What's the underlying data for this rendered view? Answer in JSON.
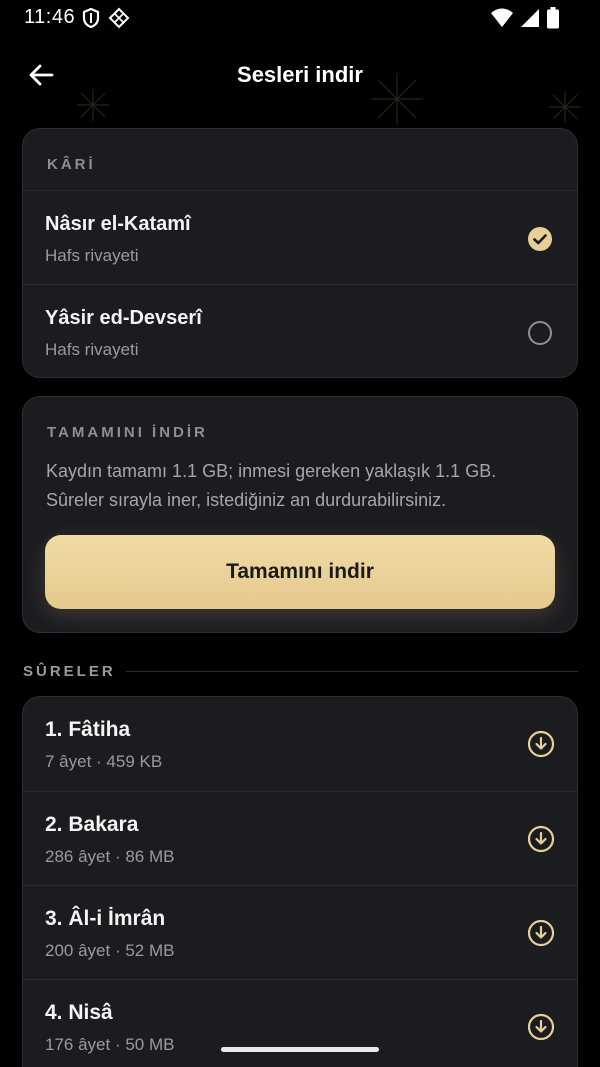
{
  "status_bar": {
    "time": "11:46"
  },
  "header": {
    "title": "Sesleri indir",
    "back_icon": "arrow-left-icon"
  },
  "reciter": {
    "section_label": "KÂRİ",
    "items": [
      {
        "name": "Nâsır el-Katamî",
        "subtitle": "Hafs rivayeti",
        "selected": true
      },
      {
        "name": "Yâsir ed-Devserî",
        "subtitle": "Hafs rivayeti",
        "selected": false
      }
    ]
  },
  "download_all": {
    "section_label": "TAMAMINI İNDİR",
    "line1": "Kaydın tamamı 1.1 GB; inmesi gereken yaklaşık 1.1 GB.",
    "line2": "Sûreler sırayla iner, istediğiniz an durdurabilirsiniz.",
    "button_label": "Tamamını indir"
  },
  "surahs": {
    "section_label": "SÛRELER",
    "items": [
      {
        "name": "1. Fâtiha",
        "meta": "7 âyet · 459 KB"
      },
      {
        "name": "2. Bakara",
        "meta": "286 âyet · 86 MB"
      },
      {
        "name": "3. Âl-i İmrân",
        "meta": "200 âyet · 52 MB"
      },
      {
        "name": "4. Nisâ",
        "meta": "176 âyet · 50 MB"
      }
    ]
  },
  "colors": {
    "background": "#000000",
    "card": "#1b1c20",
    "accent_gold": "#e8cf98",
    "muted_text": "#9a9a9e"
  }
}
